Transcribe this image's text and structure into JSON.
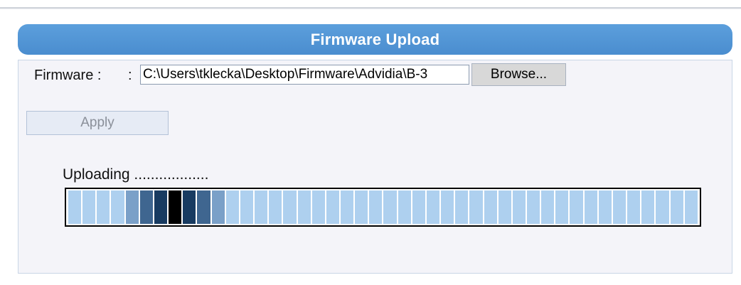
{
  "header": {
    "title": "Firmware Upload"
  },
  "form": {
    "firmware_label": "Firmware :",
    "separator": ":",
    "file_value": "C:\\Users\\tklecka\\Desktop\\Firmware\\Advidia\\B-3",
    "browse_label": "Browse...",
    "apply_label": "Apply"
  },
  "upload": {
    "status_text": "Uploading ..................",
    "segments": 44,
    "colors": {
      "idle": "#aed0ef",
      "s1": "#7aa0c8",
      "s2": "#3f6690",
      "s3": "#183b61",
      "s4": "#000000"
    },
    "pattern": [
      "idle",
      "idle",
      "idle",
      "idle",
      "s1",
      "s2",
      "s3",
      "s4",
      "s3",
      "s2",
      "s1",
      "idle",
      "idle",
      "idle",
      "idle",
      "idle",
      "idle",
      "idle",
      "idle",
      "idle",
      "idle",
      "idle",
      "idle",
      "idle",
      "idle",
      "idle",
      "idle",
      "idle",
      "idle",
      "idle",
      "idle",
      "idle",
      "idle",
      "idle",
      "idle",
      "idle",
      "idle",
      "idle",
      "idle",
      "idle",
      "idle",
      "idle",
      "idle",
      "idle"
    ]
  }
}
